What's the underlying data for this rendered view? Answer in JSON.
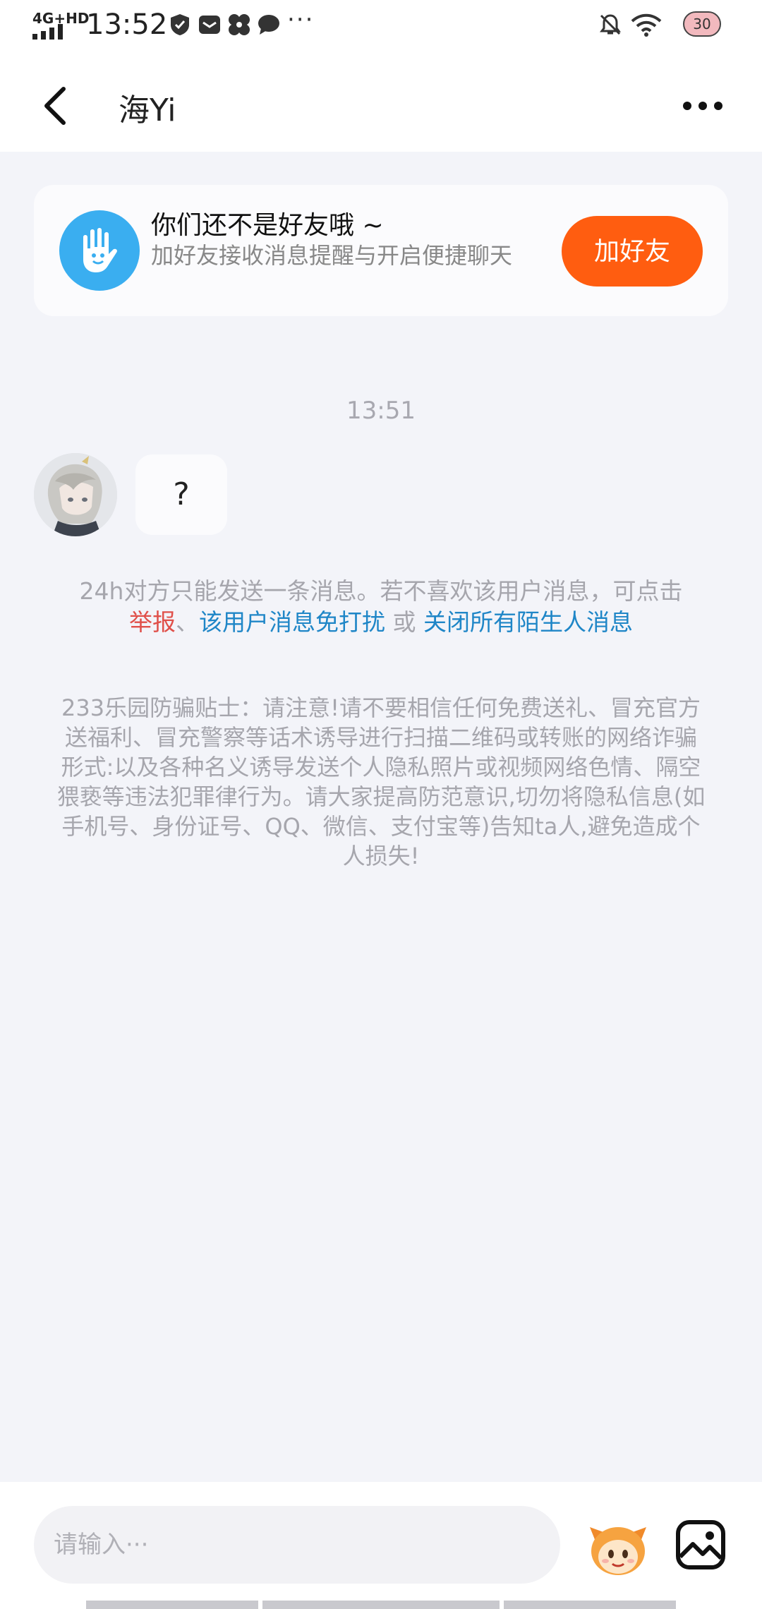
{
  "status_bar": {
    "network": "4G+HD",
    "time": "13:52",
    "overflow": "···",
    "battery": "30",
    "icons": [
      "shield-icon",
      "mail-icon",
      "fan-icon",
      "chat-bubble-icon",
      "bell-muted-icon",
      "wifi-icon",
      "battery-icon"
    ]
  },
  "header": {
    "title": "海Yi",
    "back_icon": "chevron-left-icon",
    "more_icon": "more-dots-icon"
  },
  "friend_card": {
    "title": "你们还不是好友哦 ~",
    "subtitle": "加好友接收消息提醒与开启便捷聊天",
    "button_label": "加好友",
    "icon": "hand-wave-icon",
    "accent": "#ff5d10",
    "logo_color": "#3aaef0"
  },
  "chat": {
    "timestamp": "13:51",
    "messages": [
      {
        "from": "other",
        "text": "?"
      }
    ]
  },
  "notice": {
    "prefix": "24h对方只能发送一条消息。若不喜欢该用户消息，可点击",
    "report_link": "举报",
    "sep1": "、",
    "mute_link": "该用户消息免打扰",
    "or": "或",
    "close_link": "关闭所有陌生人消息"
  },
  "tips": {
    "text": "233乐园防骗贴士：请注意!请不要相信任何免费送礼、冒充官方送福利、冒充警察等话术诱导进行扫描二维码或转账的网络诈骗形式:以及各种名义诱导发送个人隐私照片或视频网络色情、隔空猥亵等违法犯罪律行为。请大家提高防范意识,切勿将隐私信息(如手机号、身份证号、QQ、微信、支付宝等)告知ta人,避免造成个人损失!"
  },
  "input_bar": {
    "placeholder": "请输入···",
    "emoji_icon": "mascot-emoji-icon",
    "image_icon": "image-icon"
  }
}
